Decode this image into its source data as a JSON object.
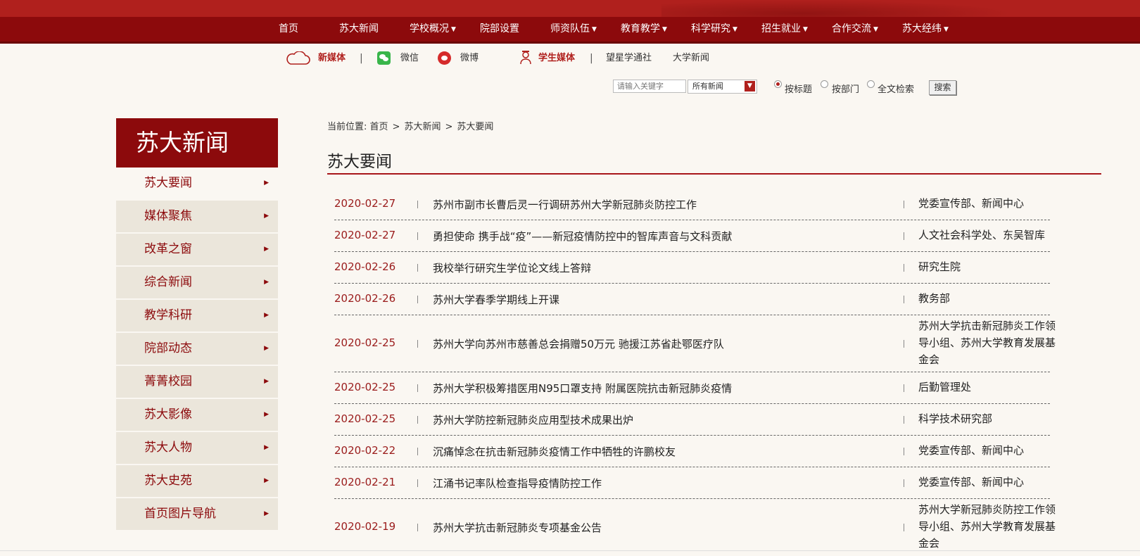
{
  "nav": {
    "items": [
      {
        "label": "首页",
        "dropdown": false
      },
      {
        "label": "苏大新闻",
        "dropdown": false
      },
      {
        "label": "学校概况",
        "dropdown": true
      },
      {
        "label": "院部设置",
        "dropdown": false
      },
      {
        "label": "师资队伍",
        "dropdown": true
      },
      {
        "label": "教育教学",
        "dropdown": true
      },
      {
        "label": "科学研究",
        "dropdown": true
      },
      {
        "label": "招生就业",
        "dropdown": true
      },
      {
        "label": "合作交流",
        "dropdown": true
      },
      {
        "label": "苏大经纬",
        "dropdown": true
      }
    ]
  },
  "media": {
    "new_media": "新媒体",
    "sep": "|",
    "wechat": "微信",
    "weibo": "微博",
    "student_media": "学生媒体",
    "wangxing": "望星学通社",
    "daxue_news": "大学新闻"
  },
  "search": {
    "placeholder": "请输入关键字",
    "scope": "所有新闻",
    "options": [
      "按标题",
      "按部门",
      "全文检索"
    ],
    "selected": "按标题",
    "button": "搜索"
  },
  "sidebar": {
    "title": "苏大新闻",
    "items": [
      {
        "label": "苏大要闻",
        "active": true
      },
      {
        "label": "媒体聚焦",
        "active": false
      },
      {
        "label": "改革之窗",
        "active": false
      },
      {
        "label": "综合新闻",
        "active": false
      },
      {
        "label": "教学科研",
        "active": false
      },
      {
        "label": "院部动态",
        "active": false
      },
      {
        "label": "菁菁校园",
        "active": false
      },
      {
        "label": "苏大影像",
        "active": false
      },
      {
        "label": "苏大人物",
        "active": false
      },
      {
        "label": "苏大史苑",
        "active": false
      },
      {
        "label": "首页图片导航",
        "active": false
      }
    ]
  },
  "breadcrumb": {
    "prefix": "当前位置:",
    "items": [
      "首页",
      "苏大新闻",
      "苏大要闻"
    ],
    "sep": ">"
  },
  "page_title": "苏大要闻",
  "news": [
    {
      "date": "2020-02-27",
      "title": "苏州市副市长曹后灵一行调研苏州大学新冠肺炎防控工作",
      "dept": "党委宣传部、新闻中心"
    },
    {
      "date": "2020-02-27",
      "title": "勇担使命 携手战“疫”——新冠疫情防控中的智库声音与文科贡献",
      "dept": "人文社会科学处、东吴智库"
    },
    {
      "date": "2020-02-26",
      "title": "我校举行研究生学位论文线上答辩",
      "dept": "研究生院"
    },
    {
      "date": "2020-02-26",
      "title": "苏州大学春季学期线上开课",
      "dept": "教务部"
    },
    {
      "date": "2020-02-25",
      "title": "苏州大学向苏州市慈善总会捐赠50万元 驰援江苏省赴鄂医疗队",
      "dept": "苏州大学抗击新冠肺炎工作领导小组、苏州大学教育发展基金会"
    },
    {
      "date": "2020-02-25",
      "title": "苏州大学积极筹措医用N95口罩支持 附属医院抗击新冠肺炎疫情",
      "dept": "后勤管理处"
    },
    {
      "date": "2020-02-25",
      "title": "苏州大学防控新冠肺炎应用型技术成果出炉",
      "dept": "科学技术研究部"
    },
    {
      "date": "2020-02-22",
      "title": "沉痛悼念在抗击新冠肺炎疫情工作中牺牲的许鹏校友",
      "dept": "党委宣传部、新闻中心"
    },
    {
      "date": "2020-02-21",
      "title": "江涌书记率队检查指导疫情防控工作",
      "dept": "党委宣传部、新闻中心"
    },
    {
      "date": "2020-02-19",
      "title": "苏州大学抗击新冠肺炎专项基金公告",
      "dept": "苏州大学新冠肺炎防控工作领导小组、苏州大学教育发展基金会"
    }
  ]
}
